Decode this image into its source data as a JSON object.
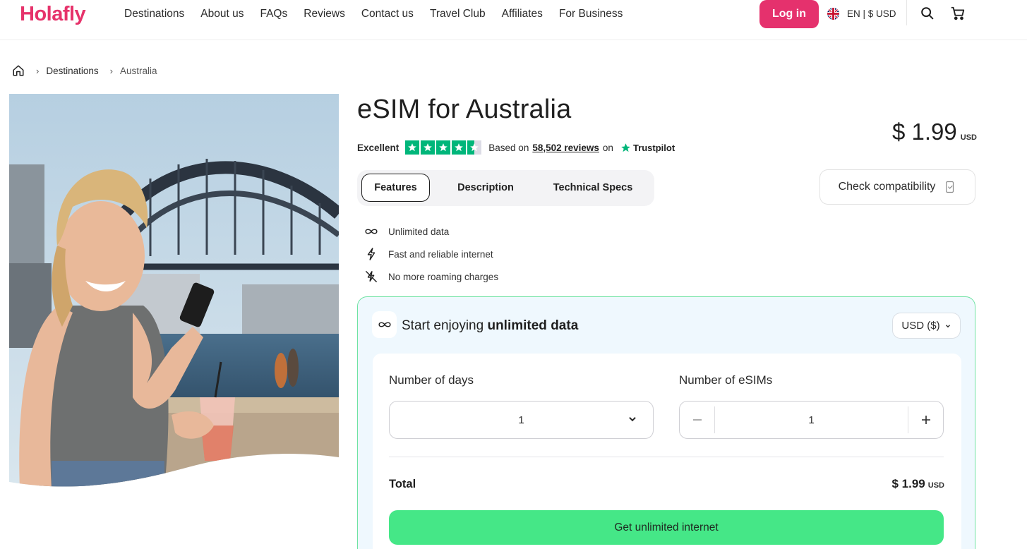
{
  "header": {
    "logo": "Holafly",
    "nav": [
      "Destinations",
      "About us",
      "FAQs",
      "Reviews",
      "Contact us",
      "Travel Club",
      "Affiliates",
      "For Business"
    ],
    "login_label": "Log in",
    "lang_currency": "EN | $ USD"
  },
  "breadcrumb": {
    "items": [
      "Destinations",
      "Australia"
    ]
  },
  "product": {
    "title": "eSIM for Australia",
    "rating_label": "Excellent",
    "rating_stars": 4.5,
    "based_on": "Based on",
    "reviews_link": "58,502 reviews",
    "on": "on",
    "trustpilot": "Trustpilot",
    "price": "$ 1.99",
    "price_currency": "USD",
    "tabs": [
      "Features",
      "Description",
      "Technical Specs"
    ],
    "active_tab": "Features",
    "compat_label": "Check compatibility",
    "features": [
      "Unlimited data",
      "Fast and reliable internet",
      "No more roaming charges"
    ]
  },
  "purchase": {
    "heading_prefix": "Start enjoying",
    "heading_strong": "unlimited data",
    "currency_select": "USD ($)",
    "days_label": "Number of days",
    "days_value": "1",
    "esims_label": "Number of eSIMs",
    "esims_value": "1",
    "total_label": "Total",
    "total_price": "$ 1.99",
    "total_currency": "USD",
    "cta_label": "Get unlimited internet"
  },
  "colors": {
    "brand": "#e5316d",
    "accent_green": "#45e787",
    "trustpilot_green": "#00b67a",
    "panel_bg": "#eff8fe"
  }
}
